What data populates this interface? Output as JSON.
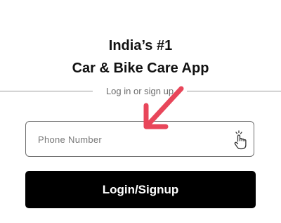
{
  "header": {
    "title_line1": "India’s #1",
    "title_line2": "Car & Bike Care App"
  },
  "divider": {
    "label": "Log in or sign up"
  },
  "phone": {
    "placeholder": "Phone Number",
    "value": "",
    "icon": "tap-hand-icon"
  },
  "login_button": {
    "label": "Login/Signup"
  },
  "hint_arrow": {
    "icon": "arrow-pointer-icon",
    "color": "#e8465a"
  },
  "colors": {
    "button_bg": "#000000",
    "button_text": "#ffffff",
    "border": "#6f6f6f",
    "muted_text": "#6b6b6b"
  }
}
